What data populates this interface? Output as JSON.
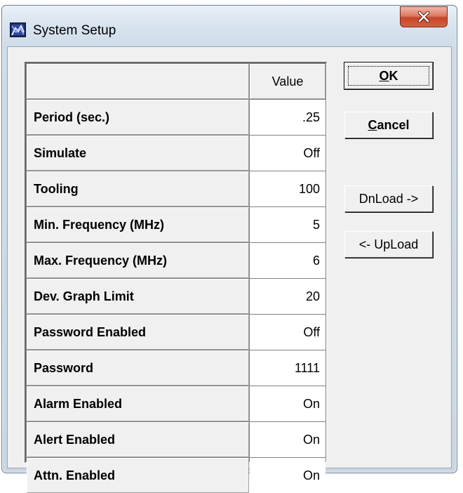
{
  "window": {
    "title": "System Setup",
    "app_icon": "system-setup-app-icon",
    "close_icon": "close-x-icon"
  },
  "grid": {
    "header": {
      "label": "",
      "value": "Value"
    },
    "rows": [
      {
        "label": "Period (sec.)",
        "value": ".25"
      },
      {
        "label": "Simulate",
        "value": "Off"
      },
      {
        "label": "Tooling",
        "value": "100"
      },
      {
        "label": "Min. Frequency (MHz)",
        "value": "5"
      },
      {
        "label": "Max. Frequency (MHz)",
        "value": "6"
      },
      {
        "label": "Dev. Graph Limit",
        "value": "20"
      },
      {
        "label": "Password Enabled",
        "value": "Off"
      },
      {
        "label": "Password",
        "value": "1111"
      },
      {
        "label": "Alarm Enabled",
        "value": "On"
      },
      {
        "label": "Alert Enabled",
        "value": "On"
      },
      {
        "label": "Attn. Enabled",
        "value": "On"
      }
    ]
  },
  "buttons": {
    "ok": {
      "mnemonic": "O",
      "rest": "K"
    },
    "cancel": {
      "mnemonic": "C",
      "rest": "ancel"
    },
    "download": "DnLoad ->",
    "upload": "<- UpLoad"
  },
  "colors": {
    "close_button": "#c6452a",
    "dialog_face": "#f0f0f0",
    "grid_line": "#808080"
  }
}
